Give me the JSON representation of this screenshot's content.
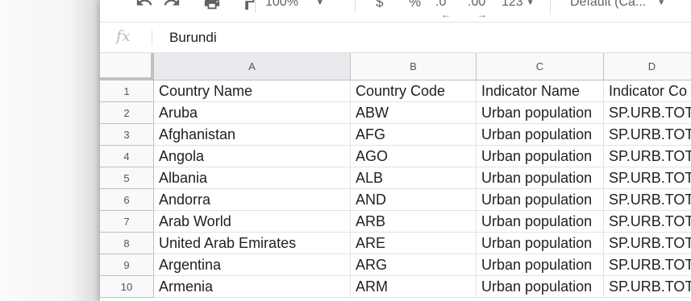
{
  "toolbar": {
    "zoom": "100%",
    "currency": "$",
    "percent": "%",
    "dec_less": ".0",
    "dec_more": ".00",
    "number_format": "123",
    "font": "Default (Ca..."
  },
  "formula_bar": {
    "fx_label": "fx",
    "value": "Burundi"
  },
  "columns": [
    "A",
    "B",
    "C",
    "D"
  ],
  "rows": [
    {
      "num": "1",
      "cells": [
        "Country Name",
        "Country Code",
        "Indicator Name",
        "Indicator Co"
      ]
    },
    {
      "num": "2",
      "cells": [
        "Aruba",
        "ABW",
        "Urban population",
        "SP.URB.TOTL"
      ]
    },
    {
      "num": "3",
      "cells": [
        "Afghanistan",
        "AFG",
        "Urban population",
        "SP.URB.TOTL"
      ]
    },
    {
      "num": "4",
      "cells": [
        "Angola",
        "AGO",
        "Urban population",
        "SP.URB.TOTL"
      ]
    },
    {
      "num": "5",
      "cells": [
        "Albania",
        "ALB",
        "Urban population",
        "SP.URB.TOTL"
      ]
    },
    {
      "num": "6",
      "cells": [
        "Andorra",
        "AND",
        "Urban population",
        "SP.URB.TOTL"
      ]
    },
    {
      "num": "7",
      "cells": [
        "Arab World",
        "ARB",
        "Urban population",
        "SP.URB.TOTL"
      ]
    },
    {
      "num": "8",
      "cells": [
        "United Arab Emirates",
        "ARE",
        "Urban population",
        "SP.URB.TOTL"
      ]
    },
    {
      "num": "9",
      "cells": [
        "Argentina",
        "ARG",
        "Urban population",
        "SP.URB.TOTL"
      ]
    },
    {
      "num": "10",
      "cells": [
        "Armenia",
        "ARM",
        "Urban population",
        "SP.URB.TOTL"
      ]
    }
  ]
}
